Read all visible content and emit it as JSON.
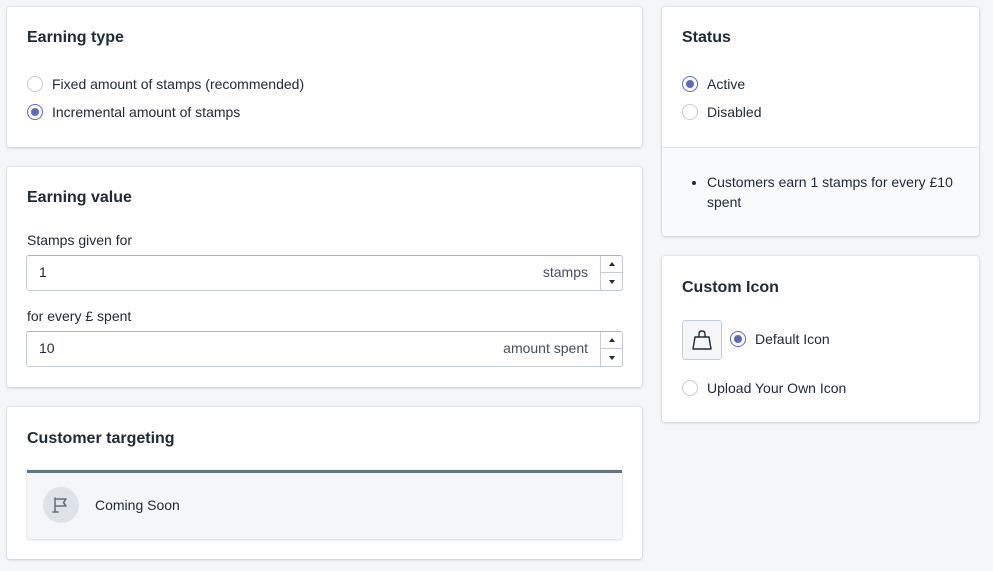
{
  "earning_type": {
    "title": "Earning type",
    "options": [
      {
        "label": "Fixed amount of stamps (recommended)",
        "checked": false
      },
      {
        "label": "Incremental amount of stamps",
        "checked": true
      }
    ]
  },
  "earning_value": {
    "title": "Earning value",
    "stamps_field": {
      "label": "Stamps given for",
      "value": "1",
      "suffix": "stamps"
    },
    "spent_field": {
      "label": "for every £ spent",
      "value": "10",
      "suffix": "amount spent"
    }
  },
  "customer_targeting": {
    "title": "Customer targeting",
    "coming_soon": "Coming Soon",
    "icon": "flag-icon"
  },
  "status": {
    "title": "Status",
    "options": [
      {
        "label": "Active",
        "checked": true
      },
      {
        "label": "Disabled",
        "checked": false
      }
    ],
    "summary": [
      "Customers earn 1 stamps for every £10 spent"
    ]
  },
  "custom_icon": {
    "title": "Custom Icon",
    "thumb_icon": "shopping-bag-icon",
    "options": [
      {
        "label": "Default Icon",
        "checked": true
      },
      {
        "label": "Upload Your Own Icon",
        "checked": false
      }
    ]
  },
  "colors": {
    "accent": "#5c6ac4",
    "background": "#f4f6f8",
    "card": "#ffffff",
    "border": "#c4cdd5"
  }
}
